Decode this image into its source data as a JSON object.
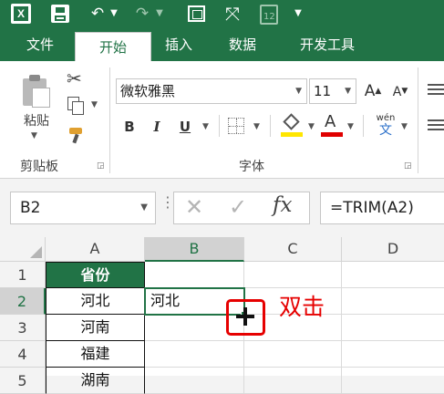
{
  "titlebar": {
    "icons": [
      "excel-icon",
      "save-icon",
      "undo-icon",
      "undo-dropdown-icon",
      "redo-icon",
      "redo-dropdown-icon",
      "screenshot-icon",
      "fullscreen-icon",
      "form-icon",
      "customize-dropdown-icon"
    ],
    "form_badge": "12",
    "accent": "#217346"
  },
  "tabs": [
    "文件",
    "开始",
    "插入",
    "数据",
    "开发工具"
  ],
  "active_tab": "开始",
  "ribbon": {
    "clipboard": {
      "paste_label": "粘贴",
      "group_label": "剪贴板"
    },
    "font": {
      "font_name": "微软雅黑",
      "font_size": "11",
      "bold": "B",
      "italic": "I",
      "underline": "U",
      "grow": "A",
      "shrink": "A",
      "font_color_letter": "A",
      "phonetic_top": "wén",
      "phonetic_bottom": "文",
      "group_label": "字体",
      "fill_color": "#ffe600",
      "font_color": "#e00000"
    }
  },
  "formula_bar": {
    "name_box": "B2",
    "formula": "=TRIM(A2)"
  },
  "grid": {
    "columns": [
      "A",
      "B",
      "C",
      "D"
    ],
    "rows": [
      "1",
      "2",
      "3",
      "4",
      "5"
    ],
    "header_cell": "省份",
    "col_a": [
      "河北",
      "河南",
      "福建",
      "湖南"
    ],
    "b2": "河北",
    "header_fill": "#217346",
    "selection_color": "#217346"
  },
  "annotation": {
    "label": "双击",
    "color": "#e60000"
  }
}
